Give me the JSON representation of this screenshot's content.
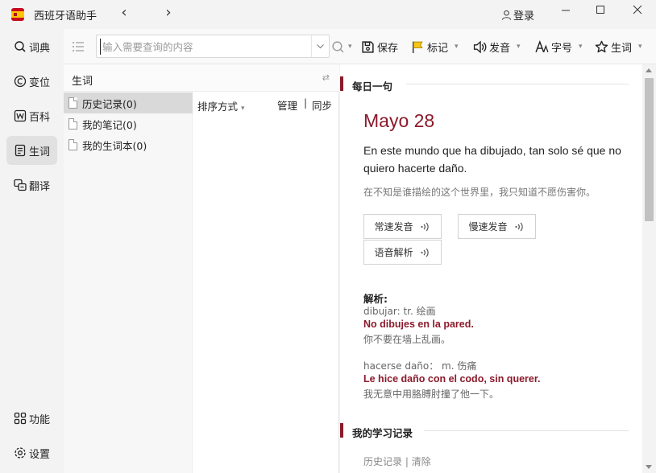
{
  "app": {
    "title": "西班牙语助手",
    "login_label": "登录"
  },
  "nav": {
    "items": [
      {
        "label": "词典",
        "icon": "search-icon"
      },
      {
        "label": "变位",
        "icon": "conjugation-icon"
      },
      {
        "label": "百科",
        "icon": "wiki-icon"
      },
      {
        "label": "生词",
        "icon": "notebook-icon",
        "active": true
      },
      {
        "label": "翻译",
        "icon": "translate-icon"
      }
    ],
    "bottom": [
      {
        "label": "功能",
        "icon": "grid-icon"
      },
      {
        "label": "设置",
        "icon": "gear-icon"
      }
    ]
  },
  "toolbar": {
    "search_placeholder": "输入需要查询的内容",
    "save_label": "保存",
    "bookmark_label": "标记",
    "pronounce_label": "发音",
    "font_label": "字号",
    "vocab_label": "生词"
  },
  "wordlist": {
    "title": "生词",
    "categories": [
      "历史记录(0)",
      "我的笔记(0)",
      "我的生词本(0)"
    ],
    "sort_label": "排序方式",
    "manage_label": "管理",
    "separator": "|",
    "sync_label": "同步"
  },
  "daily": {
    "section_title": "每日一句",
    "date": "Mayo 28",
    "sentence_es": "En este mundo que ha dibujado, tan solo sé que no quiero hacerte daño.",
    "sentence_zh": "在不知是谁描绘的这个世界里，我只知道不愿伤害你。",
    "buttons": [
      "常速发音",
      "慢速发音",
      "语音解析"
    ],
    "analysis_title": "解析:",
    "analysis": [
      {
        "term": "dibujar: tr. 绘画",
        "example": "No dibujes en la pared.",
        "translation": "你不要在墙上乱画。"
      },
      {
        "term": "hacerse daño： m. 伤痛",
        "example": "Le hice daño con el codo, sin querer.",
        "translation": "我无意中用胳膊肘撞了他一下。"
      }
    ]
  },
  "study": {
    "section_title": "我的学习记录",
    "history_link": "历史记录",
    "divider": "|",
    "clear_link": "清除"
  },
  "colors": {
    "accent": "#8b1a2b",
    "active_nav": "#e1e1e1"
  }
}
